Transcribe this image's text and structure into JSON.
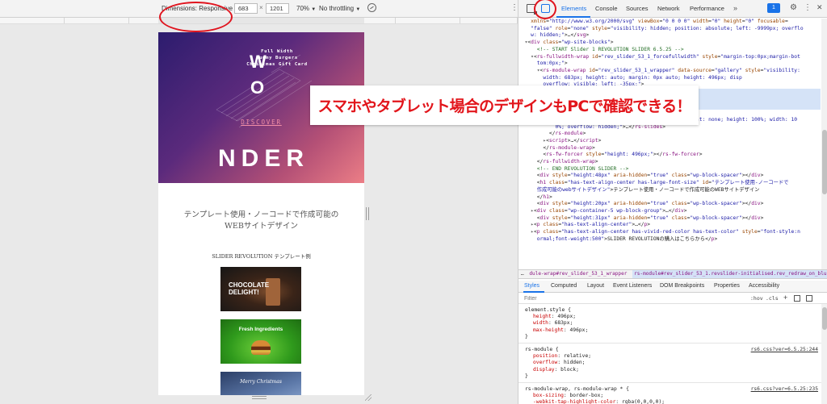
{
  "device_toolbar": {
    "dimensions_label": "Dimensions: Responsive",
    "width_value": "683",
    "height_value": "1201",
    "times": "×",
    "zoom": "70%",
    "throttle": "No throttling"
  },
  "device_page": {
    "hero_top_text": [
      "Full Width",
      "Yummy Burgers",
      "Christmas Gift Card"
    ],
    "hero_w": "W",
    "hero_o": "O",
    "discover": "DISCOVER",
    "nder": "NDER",
    "heading_line1": "テンプレート使用・ノーコードで作成可能の",
    "heading_line2": "WEBサイトデザイン",
    "slider_label": "SLIDER REVOLUTION テンプレート例",
    "thumb1_title": [
      "CHOCOLATE",
      "DELIGHT!"
    ],
    "thumb2_title": "Fresh Ingredients",
    "thumb3_title": "Merry Christmas"
  },
  "devtools": {
    "tabs": [
      "Elements",
      "Console",
      "Sources",
      "Network",
      "Performance"
    ],
    "more": "»",
    "badge": "1",
    "dom_lines": [
      [
        [
          "tx",
          "    "
        ],
        [
          "at",
          "xmlns"
        ],
        [
          "tx",
          "="
        ],
        [
          "av",
          "\"http://www.w3.org/2000/svg\""
        ],
        [
          "tx",
          " "
        ],
        [
          "at",
          "viewBox"
        ],
        [
          "tx",
          "="
        ],
        [
          "av",
          "\"0 0 0 0\""
        ],
        [
          "tx",
          " "
        ],
        [
          "at",
          "width"
        ],
        [
          "tx",
          "="
        ],
        [
          "av",
          "\"0\""
        ],
        [
          "tx",
          " "
        ],
        [
          "at",
          "height"
        ],
        [
          "tx",
          "="
        ],
        [
          "av",
          "\"0\""
        ],
        [
          "tx",
          " "
        ],
        [
          "at",
          "focusable"
        ],
        [
          "tx",
          "="
        ]
      ],
      [
        [
          "av",
          "    \"false\""
        ],
        [
          "tx",
          " "
        ],
        [
          "at",
          "role"
        ],
        [
          "tx",
          "="
        ],
        [
          "av",
          "\"none\""
        ],
        [
          "tx",
          " "
        ],
        [
          "at",
          "style"
        ],
        [
          "tx",
          "="
        ],
        [
          "av",
          "\"visibility: hidden; position: absolute; left: -9999px; overflo"
        ]
      ],
      [
        [
          "av",
          "    w: hidden;\""
        ],
        [
          "tx",
          ">…</"
        ],
        [
          "tg",
          "svg"
        ],
        [
          "tx",
          ">"
        ]
      ],
      [
        [
          "ar",
          "  ▾"
        ],
        [
          "tx",
          "<"
        ],
        [
          "tg",
          "div"
        ],
        [
          "tx",
          " "
        ],
        [
          "at",
          "class"
        ],
        [
          "tx",
          "="
        ],
        [
          "av",
          "\"wp-site-blocks\""
        ],
        [
          "tx",
          ">"
        ]
      ],
      [
        [
          "cm",
          "      <!-- START Slider 1 REVOLUTION SLIDER 6.5.25 -->"
        ]
      ],
      [
        [
          "ar",
          "    ▾"
        ],
        [
          "tx",
          "<"
        ],
        [
          "tg",
          "rs-fullwidth-wrap"
        ],
        [
          "tx",
          " "
        ],
        [
          "at",
          "id"
        ],
        [
          "tx",
          "="
        ],
        [
          "av",
          "\"rev_slider_53_1_forcefullwidth\""
        ],
        [
          "tx",
          " "
        ],
        [
          "at",
          "style"
        ],
        [
          "tx",
          "="
        ],
        [
          "av",
          "\"margin-top:0px;margin-bot"
        ]
      ],
      [
        [
          "av",
          "      tom:0px;\""
        ],
        [
          "tx",
          ">"
        ]
      ],
      [
        [
          "ar",
          "      ▾"
        ],
        [
          "tx",
          "<"
        ],
        [
          "tg",
          "rs-module-wrap"
        ],
        [
          "tx",
          " "
        ],
        [
          "at",
          "id"
        ],
        [
          "tx",
          "="
        ],
        [
          "av",
          "\"rev_slider_53_1_wrapper\""
        ],
        [
          "tx",
          " "
        ],
        [
          "at",
          "data-source"
        ],
        [
          "tx",
          "="
        ],
        [
          "av",
          "\"gallery\""
        ],
        [
          "tx",
          " "
        ],
        [
          "at",
          "style"
        ],
        [
          "tx",
          "="
        ],
        [
          "av",
          "\"visibility:"
        ]
      ],
      [
        [
          "av",
          "        width: 683px; height: auto; margin: 0px auto; height: 496px; disp"
        ]
      ],
      [
        [
          "av",
          "        overflow: visible; left: -35px;\""
        ],
        [
          "tx",
          ">"
        ]
      ],
      [
        [
          "av",
          "        ht: 496px; width: 683px; max-height: 496"
        ]
      ],
      [
        [
          "tx",
          "        "
        ],
        [
          "at",
          "class"
        ],
        [
          "tx",
          "="
        ],
        [
          "av",
          "\"revslider-initialised rev_red"
        ]
      ],
      [
        [
          "tx",
          "                                              "
        ],
        [
          "cm",
          "== $0"
        ]
      ],
      [
        [
          "tx",
          "          </"
        ],
        [
          "tg",
          "rs-progress"
        ],
        [
          "tx",
          ">"
        ]
      ],
      [
        [
          "ar",
          "          ▸"
        ],
        [
          "tx",
          "<"
        ],
        [
          "tg",
          "rs-slides"
        ],
        [
          "tx",
          " "
        ],
        [
          "at",
          "style"
        ],
        [
          "tx",
          "="
        ],
        [
          "av",
          "\"visibility: visible; max-height: none; height: 100%; width: 10"
        ]
      ],
      [
        [
          "av",
          "            0%; overflow: hidden;\""
        ],
        [
          "tx",
          ">…</"
        ],
        [
          "tg",
          "rs-slides"
        ],
        [
          "tx",
          ">"
        ]
      ],
      [
        [
          "tx",
          "          </"
        ],
        [
          "tg",
          "rs-module"
        ],
        [
          "tx",
          ">"
        ]
      ],
      [
        [
          "ar",
          "        ▸"
        ],
        [
          "tx",
          "<"
        ],
        [
          "tg",
          "script"
        ],
        [
          "tx",
          ">…</"
        ],
        [
          "tg",
          "script"
        ],
        [
          "tx",
          ">"
        ]
      ],
      [
        [
          "tx",
          "        </"
        ],
        [
          "tg",
          "rs-module-wrap"
        ],
        [
          "tx",
          ">"
        ]
      ],
      [
        [
          "tx",
          "        <"
        ],
        [
          "tg",
          "rs-fw-forcer"
        ],
        [
          "tx",
          " "
        ],
        [
          "at",
          "style"
        ],
        [
          "tx",
          "="
        ],
        [
          "av",
          "\"height: 496px;\""
        ],
        [
          "tx",
          "></"
        ],
        [
          "tg",
          "rs-fw-forcer"
        ],
        [
          "tx",
          ">"
        ]
      ],
      [
        [
          "tx",
          "      </"
        ],
        [
          "tg",
          "rs-fullwidth-wrap"
        ],
        [
          "tx",
          ">"
        ]
      ],
      [
        [
          "cm",
          "      <!-- END REVOLUTION SLIDER -->"
        ]
      ],
      [
        [
          "tx",
          "      <"
        ],
        [
          "tg",
          "div"
        ],
        [
          "tx",
          " "
        ],
        [
          "at",
          "style"
        ],
        [
          "tx",
          "="
        ],
        [
          "av",
          "\"height:48px\""
        ],
        [
          "tx",
          " "
        ],
        [
          "at",
          "aria-hidden"
        ],
        [
          "tx",
          "="
        ],
        [
          "av",
          "\"true\""
        ],
        [
          "tx",
          " "
        ],
        [
          "at",
          "class"
        ],
        [
          "tx",
          "="
        ],
        [
          "av",
          "\"wp-block-spacer\""
        ],
        [
          "tx",
          "></"
        ],
        [
          "tg",
          "div"
        ],
        [
          "tx",
          ">"
        ]
      ],
      [
        [
          "tx",
          "      <"
        ],
        [
          "tg",
          "h1"
        ],
        [
          "tx",
          " "
        ],
        [
          "at",
          "class"
        ],
        [
          "tx",
          "="
        ],
        [
          "av",
          "\"has-text-align-center has-large-font-size\""
        ],
        [
          "tx",
          " "
        ],
        [
          "at",
          "id"
        ],
        [
          "tx",
          "="
        ],
        [
          "av",
          "\"テンプレート使用-ノーコードで"
        ]
      ],
      [
        [
          "av",
          "      作成可能のwebサイトデザイン\""
        ],
        [
          "tx",
          ">テンプレート使用・ノーコードで作成可能のWEBサイトデザイン"
        ]
      ],
      [
        [
          "tx",
          "      </"
        ],
        [
          "tg",
          "h1"
        ],
        [
          "tx",
          ">"
        ]
      ],
      [
        [
          "tx",
          "      <"
        ],
        [
          "tg",
          "div"
        ],
        [
          "tx",
          " "
        ],
        [
          "at",
          "style"
        ],
        [
          "tx",
          "="
        ],
        [
          "av",
          "\"height:20px\""
        ],
        [
          "tx",
          " "
        ],
        [
          "at",
          "aria-hidden"
        ],
        [
          "tx",
          "="
        ],
        [
          "av",
          "\"true\""
        ],
        [
          "tx",
          " "
        ],
        [
          "at",
          "class"
        ],
        [
          "tx",
          "="
        ],
        [
          "av",
          "\"wp-block-spacer\""
        ],
        [
          "tx",
          "></"
        ],
        [
          "tg",
          "div"
        ],
        [
          "tx",
          ">"
        ]
      ],
      [
        [
          "ar",
          "    ▸"
        ],
        [
          "tx",
          "<"
        ],
        [
          "tg",
          "div"
        ],
        [
          "tx",
          " "
        ],
        [
          "at",
          "class"
        ],
        [
          "tx",
          "="
        ],
        [
          "av",
          "\"wp-container-5 wp-block-group\""
        ],
        [
          "tx",
          ">…</"
        ],
        [
          "tg",
          "div"
        ],
        [
          "tx",
          ">"
        ]
      ],
      [
        [
          "tx",
          "      <"
        ],
        [
          "tg",
          "div"
        ],
        [
          "tx",
          " "
        ],
        [
          "at",
          "style"
        ],
        [
          "tx",
          "="
        ],
        [
          "av",
          "\"height:31px\""
        ],
        [
          "tx",
          " "
        ],
        [
          "at",
          "aria-hidden"
        ],
        [
          "tx",
          "="
        ],
        [
          "av",
          "\"true\""
        ],
        [
          "tx",
          " "
        ],
        [
          "at",
          "class"
        ],
        [
          "tx",
          "="
        ],
        [
          "av",
          "\"wp-block-spacer\""
        ],
        [
          "tx",
          "></"
        ],
        [
          "tg",
          "div"
        ],
        [
          "tx",
          ">"
        ]
      ],
      [
        [
          "ar",
          "    ▸"
        ],
        [
          "tx",
          "<"
        ],
        [
          "tg",
          "p"
        ],
        [
          "tx",
          " "
        ],
        [
          "at",
          "class"
        ],
        [
          "tx",
          "="
        ],
        [
          "av",
          "\"has-text-align-center\""
        ],
        [
          "tx",
          ">…</"
        ],
        [
          "tg",
          "p"
        ],
        [
          "tx",
          ">"
        ]
      ],
      [
        [
          "ar",
          "    ▸"
        ],
        [
          "tx",
          "<"
        ],
        [
          "tg",
          "p"
        ],
        [
          "tx",
          " "
        ],
        [
          "at",
          "class"
        ],
        [
          "tx",
          "="
        ],
        [
          "av",
          "\"has-text-align-center has-vivid-red-color has-text-color\""
        ],
        [
          "tx",
          " "
        ],
        [
          "at",
          "style"
        ],
        [
          "tx",
          "="
        ],
        [
          "av",
          "\"font-style:n"
        ]
      ],
      [
        [
          "av",
          "      ormal;font-weight:500\""
        ],
        [
          "tx",
          ">SLIDER REVOLUTIONの購入はこちらから</"
        ],
        [
          "tg",
          "p"
        ],
        [
          "tx",
          ">"
        ]
      ]
    ],
    "breadcrumbs": [
      "…",
      "dule-wrap#rev_slider_53_1_wrapper",
      "rs-module#rev_slider_53_1.revslider-initialised.rev_redraw_on_blurfocus"
    ],
    "styles_tabs": [
      "Styles",
      "Computed",
      "Layout",
      "Event Listeners",
      "DOM Breakpoints",
      "Properties",
      "Accessibility"
    ],
    "filter_placeholder": "Filter",
    "hov": ":hov",
    "cls": ".cls",
    "plus": "+",
    "style_rules": [
      {
        "selector": "element.style {",
        "props": [
          [
            "height",
            "496px;"
          ],
          [
            "width",
            "683px;"
          ],
          [
            "max-height",
            "496px;"
          ]
        ],
        "close": "}",
        "source": ""
      },
      {
        "selector": "rs-module {",
        "props": [
          [
            "position",
            "relative;"
          ],
          [
            "overflow",
            "hidden;"
          ],
          [
            "display",
            "block;"
          ]
        ],
        "close": "}",
        "source": "rs6.css?ver=6.5.25:244"
      },
      {
        "selector": "rs-module-wrap, rs-module-wrap * {",
        "props": [
          [
            "box-sizing",
            "border-box;"
          ],
          [
            "-webkit-tap-highlight-color",
            "rgba(0,0,0,0);"
          ]
        ],
        "close": "",
        "source": "rs6.css?ver=6.5.25:235"
      }
    ]
  },
  "overlay": {
    "text": "スマホやタブレット場合のデザインもPCで確認できる！",
    "color": "#e2151b"
  },
  "colors": {
    "accent": "#1a73e8",
    "highlight_circle": "#e0141e"
  }
}
